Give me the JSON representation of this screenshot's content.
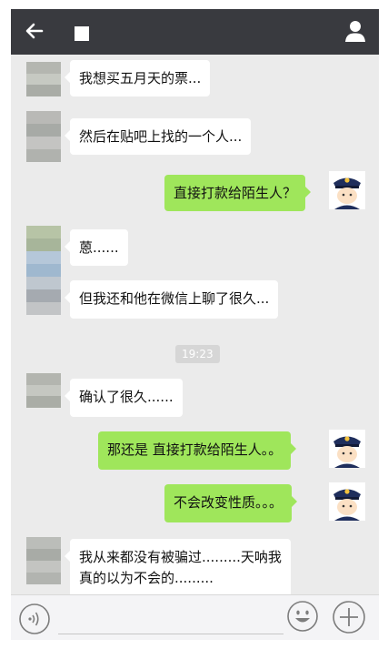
{
  "header": {
    "icons": [
      "back-arrow-icon",
      "person-icon"
    ]
  },
  "messages": [
    {
      "side": "left",
      "text": "我想买五月天的票..."
    },
    {
      "side": "left",
      "text": "然后在贴吧上找的一个人..."
    },
    {
      "side": "right",
      "text": "直接打款给陌生人？"
    },
    {
      "side": "left",
      "text": "蒽......"
    },
    {
      "side": "left",
      "text": "但我还和他在微信上聊了很久..."
    },
    {
      "side": "left",
      "text": "确认了很久......"
    },
    {
      "side": "right",
      "text": "那还是 直接打款给陌生人。。"
    },
    {
      "side": "right",
      "text": "不会改变性质。。。"
    },
    {
      "side": "left",
      "line1": "我从来都没有被骗过.........天呐我",
      "line2": "真的以为不会的........."
    }
  ],
  "timestamp": "19:23",
  "inputbar": {
    "icons": [
      "voice-icon",
      "emoji-icon",
      "plus-icon"
    ]
  },
  "colors": {
    "topbar": "#393a3f",
    "chat_bg": "#ebebeb",
    "own_bubble": "#9fe65b",
    "other_bubble": "#ffffff"
  }
}
